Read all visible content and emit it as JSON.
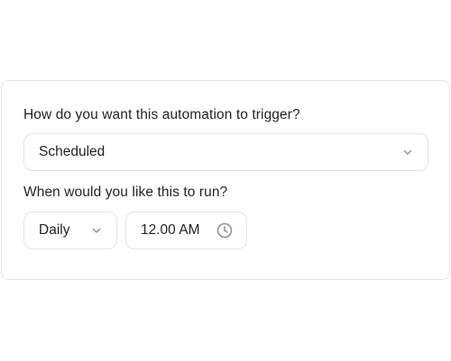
{
  "trigger": {
    "question": "How do you want this automation to trigger?",
    "selected": "Scheduled"
  },
  "schedule": {
    "question": "When would you like this to run?",
    "frequency": "Daily",
    "time": "12.00 AM"
  },
  "icons": {
    "trigger_chevron": "chevron-down-icon",
    "frequency_chevron": "chevron-down-icon",
    "time_icon": "clock-icon"
  },
  "colors": {
    "border": "#e4e4e7",
    "text": "#1f2328",
    "icon": "#8a8f98"
  }
}
